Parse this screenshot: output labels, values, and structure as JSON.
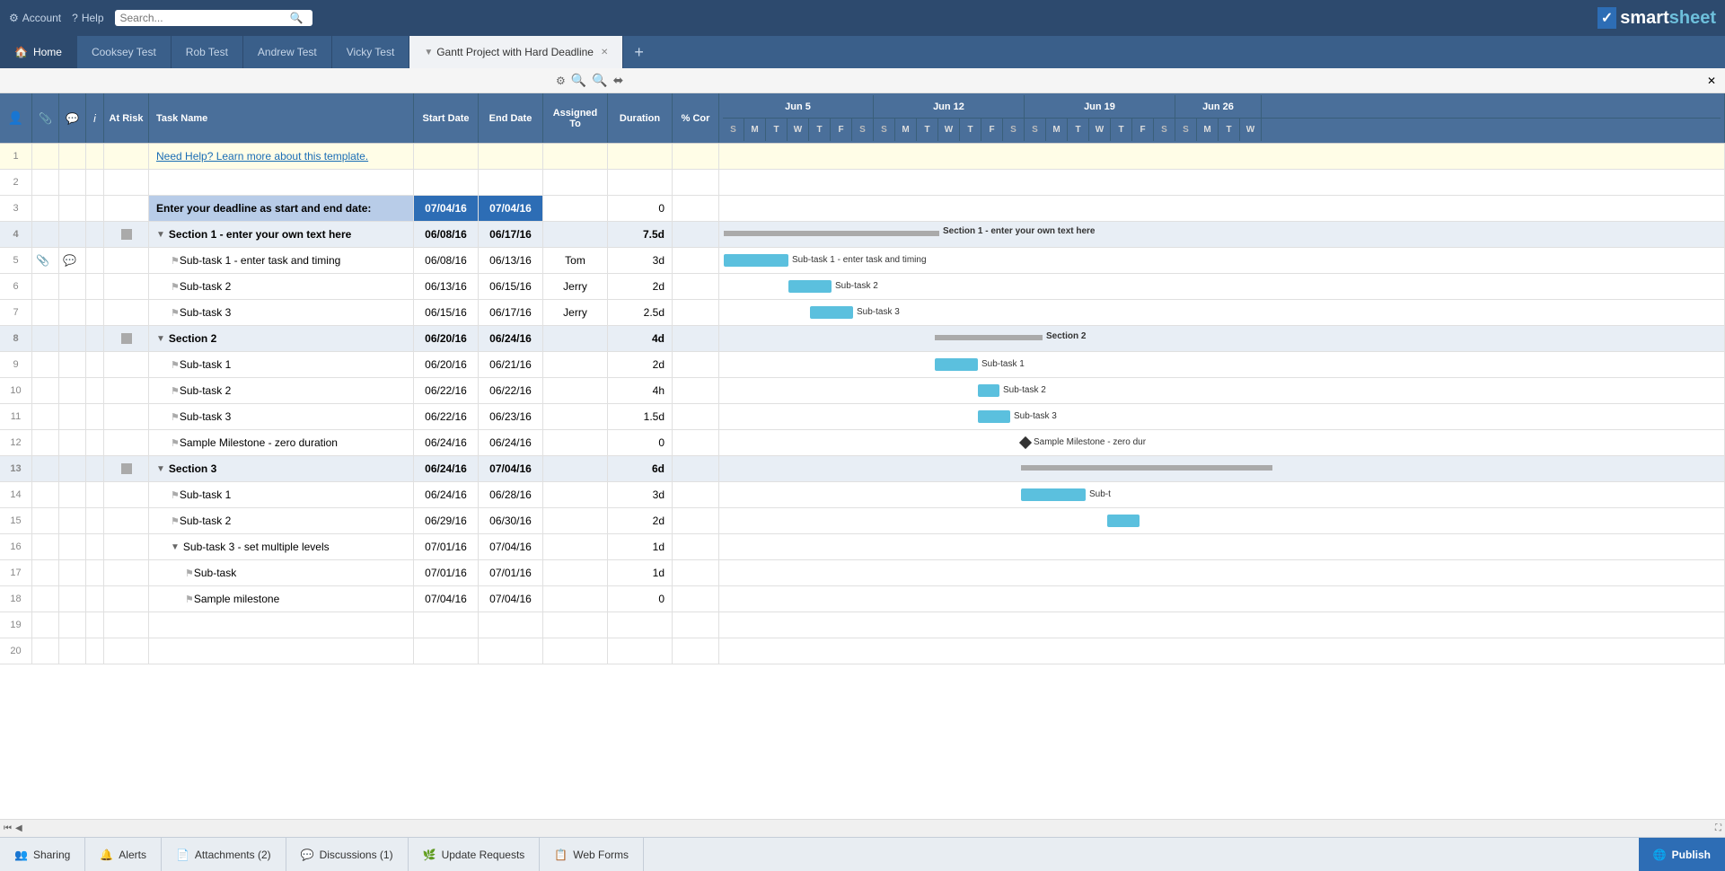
{
  "app": {
    "logo_text": "smartsheet",
    "logo_check": "✓"
  },
  "top_nav": {
    "account": "Account",
    "help": "Help",
    "search_placeholder": "Search..."
  },
  "tabs": [
    {
      "label": "Home",
      "type": "home"
    },
    {
      "label": "Cooksey Test",
      "type": "normal"
    },
    {
      "label": "Rob Test",
      "type": "normal"
    },
    {
      "label": "Andrew Test",
      "type": "normal"
    },
    {
      "label": "Vicky Test",
      "type": "normal"
    },
    {
      "label": "Gantt Project with Hard Deadline",
      "type": "active"
    }
  ],
  "header_cols": {
    "at_risk": "At Risk",
    "task_name": "Task Name",
    "start_date": "Start Date",
    "end_date": "End Date",
    "assigned_to": "Assigned To",
    "duration": "Duration",
    "cor": "% Cor"
  },
  "gantt_weeks": [
    {
      "label": "Jun 5",
      "days": 7
    },
    {
      "label": "Jun 12",
      "days": 7
    },
    {
      "label": "Jun 19",
      "days": 7
    },
    {
      "label": "Jun 26",
      "days": 4
    }
  ],
  "gantt_days": [
    "S",
    "M",
    "T",
    "W",
    "T",
    "F",
    "S",
    "S",
    "M",
    "T",
    "W",
    "T",
    "F",
    "S",
    "S",
    "M",
    "T",
    "W",
    "T",
    "F",
    "S",
    "S",
    "M",
    "T",
    "W"
  ],
  "rows": [
    {
      "num": "1",
      "task": "Need Help? Learn more about this template.",
      "type": "help",
      "start": "",
      "end": "",
      "assigned": "",
      "duration": "",
      "cor": ""
    },
    {
      "num": "2",
      "task": "",
      "type": "empty",
      "start": "",
      "end": "",
      "assigned": "",
      "duration": "",
      "cor": ""
    },
    {
      "num": "3",
      "task": "Enter your deadline as start and end date:",
      "type": "deadline",
      "start": "07/04/16",
      "end": "07/04/16",
      "assigned": "",
      "duration": "0",
      "cor": ""
    },
    {
      "num": "4",
      "task": "Section 1 - enter your own text here",
      "type": "section",
      "start": "06/08/16",
      "end": "06/17/16",
      "assigned": "",
      "duration": "7.5d",
      "cor": "",
      "indent": 0,
      "expand": true,
      "gantt_start": 5,
      "gantt_width": 96,
      "gantt_type": "section",
      "gantt_label": "Section 1 - enter your own text here"
    },
    {
      "num": "5",
      "task": "Sub-task 1 - enter task and timing",
      "type": "task",
      "start": "06/08/16",
      "end": "06/13/16",
      "assigned": "Tom",
      "duration": "3d",
      "cor": "",
      "indent": 1,
      "gantt_start": 5,
      "gantt_width": 48,
      "gantt_type": "blue",
      "gantt_label": "Sub-task 1 - enter task and timing",
      "has_attach": true,
      "has_chat": true
    },
    {
      "num": "6",
      "task": "Sub-task 2",
      "type": "task",
      "start": "06/13/16",
      "end": "06/15/16",
      "assigned": "Jerry",
      "duration": "2d",
      "cor": "",
      "indent": 1,
      "gantt_start": 53,
      "gantt_width": 48,
      "gantt_type": "blue",
      "gantt_label": "Sub-task 2"
    },
    {
      "num": "7",
      "task": "Sub-task 3",
      "type": "task",
      "start": "06/15/16",
      "end": "06/17/16",
      "assigned": "Jerry",
      "duration": "2.5d",
      "cor": "",
      "indent": 1,
      "gantt_start": 77,
      "gantt_width": 48,
      "gantt_type": "blue",
      "gantt_label": "Sub-task 3"
    },
    {
      "num": "8",
      "task": "Section 2",
      "type": "section",
      "start": "06/20/16",
      "end": "06/24/16",
      "assigned": "",
      "duration": "4d",
      "cor": "",
      "indent": 0,
      "expand": true,
      "gantt_start": 149,
      "gantt_width": 96,
      "gantt_type": "section",
      "gantt_label": "Section 2"
    },
    {
      "num": "9",
      "task": "Sub-task 1",
      "type": "task",
      "start": "06/20/16",
      "end": "06/21/16",
      "assigned": "",
      "duration": "2d",
      "cor": "",
      "indent": 1,
      "gantt_start": 149,
      "gantt_width": 24,
      "gantt_type": "blue",
      "gantt_label": "Sub-task 1"
    },
    {
      "num": "10",
      "task": "Sub-task 2",
      "type": "task",
      "start": "06/22/16",
      "end": "06/22/16",
      "assigned": "",
      "duration": "4h",
      "cor": "",
      "indent": 1,
      "gantt_start": 197,
      "gantt_width": 12,
      "gantt_type": "blue",
      "gantt_label": "Sub-task 2"
    },
    {
      "num": "11",
      "task": "Sub-task 3",
      "type": "task",
      "start": "06/22/16",
      "end": "06/23/16",
      "assigned": "",
      "duration": "1.5d",
      "cor": "",
      "indent": 1,
      "gantt_start": 197,
      "gantt_width": 24,
      "gantt_type": "blue",
      "gantt_label": "Sub-task 3"
    },
    {
      "num": "12",
      "task": "Sample Milestone - zero duration",
      "type": "task",
      "start": "06/24/16",
      "end": "06/24/16",
      "assigned": "",
      "duration": "0",
      "cor": "",
      "indent": 1,
      "gantt_start": 245,
      "gantt_width": 0,
      "gantt_type": "milestone",
      "gantt_label": "Sample Milestone - zero dur"
    },
    {
      "num": "13",
      "task": "Section 3",
      "type": "section",
      "start": "06/24/16",
      "end": "07/04/16",
      "assigned": "",
      "duration": "6d",
      "cor": "",
      "indent": 0,
      "expand": true,
      "gantt_start": 245,
      "gantt_width": 240,
      "gantt_type": "section",
      "gantt_label": ""
    },
    {
      "num": "14",
      "task": "Sub-task 1",
      "type": "task",
      "start": "06/24/16",
      "end": "06/28/16",
      "assigned": "",
      "duration": "3d",
      "cor": "",
      "indent": 1,
      "gantt_start": 245,
      "gantt_width": 72,
      "gantt_type": "blue",
      "gantt_label": "Sub-t"
    },
    {
      "num": "15",
      "task": "Sub-task 2",
      "type": "task",
      "start": "06/29/16",
      "end": "06/30/16",
      "assigned": "",
      "duration": "2d",
      "cor": "",
      "indent": 1,
      "gantt_start": 317,
      "gantt_width": 36,
      "gantt_type": "blue",
      "gantt_label": ""
    },
    {
      "num": "16",
      "task": "Sub-task 3 - set multiple levels",
      "type": "task",
      "start": "07/01/16",
      "end": "07/04/16",
      "assigned": "",
      "duration": "1d",
      "cor": "",
      "indent": 1,
      "expand": true
    },
    {
      "num": "17",
      "task": "Sub-task",
      "type": "task",
      "start": "07/01/16",
      "end": "07/01/16",
      "assigned": "",
      "duration": "1d",
      "cor": "",
      "indent": 2
    },
    {
      "num": "18",
      "task": "Sample milestone",
      "type": "task",
      "start": "07/04/16",
      "end": "07/04/16",
      "assigned": "",
      "duration": "0",
      "cor": "",
      "indent": 2
    },
    {
      "num": "19",
      "task": "",
      "type": "empty",
      "start": "",
      "end": "",
      "assigned": "",
      "duration": "",
      "cor": ""
    },
    {
      "num": "20",
      "task": "",
      "type": "empty",
      "start": "",
      "end": "",
      "assigned": "",
      "duration": "",
      "cor": ""
    }
  ],
  "bottom_bar": {
    "sharing": "Sharing",
    "alerts": "Alerts",
    "attachments": "Attachments (2)",
    "discussions": "Discussions (1)",
    "update_requests": "Update Requests",
    "web_forms": "Web Forms",
    "publish": "Publish"
  }
}
